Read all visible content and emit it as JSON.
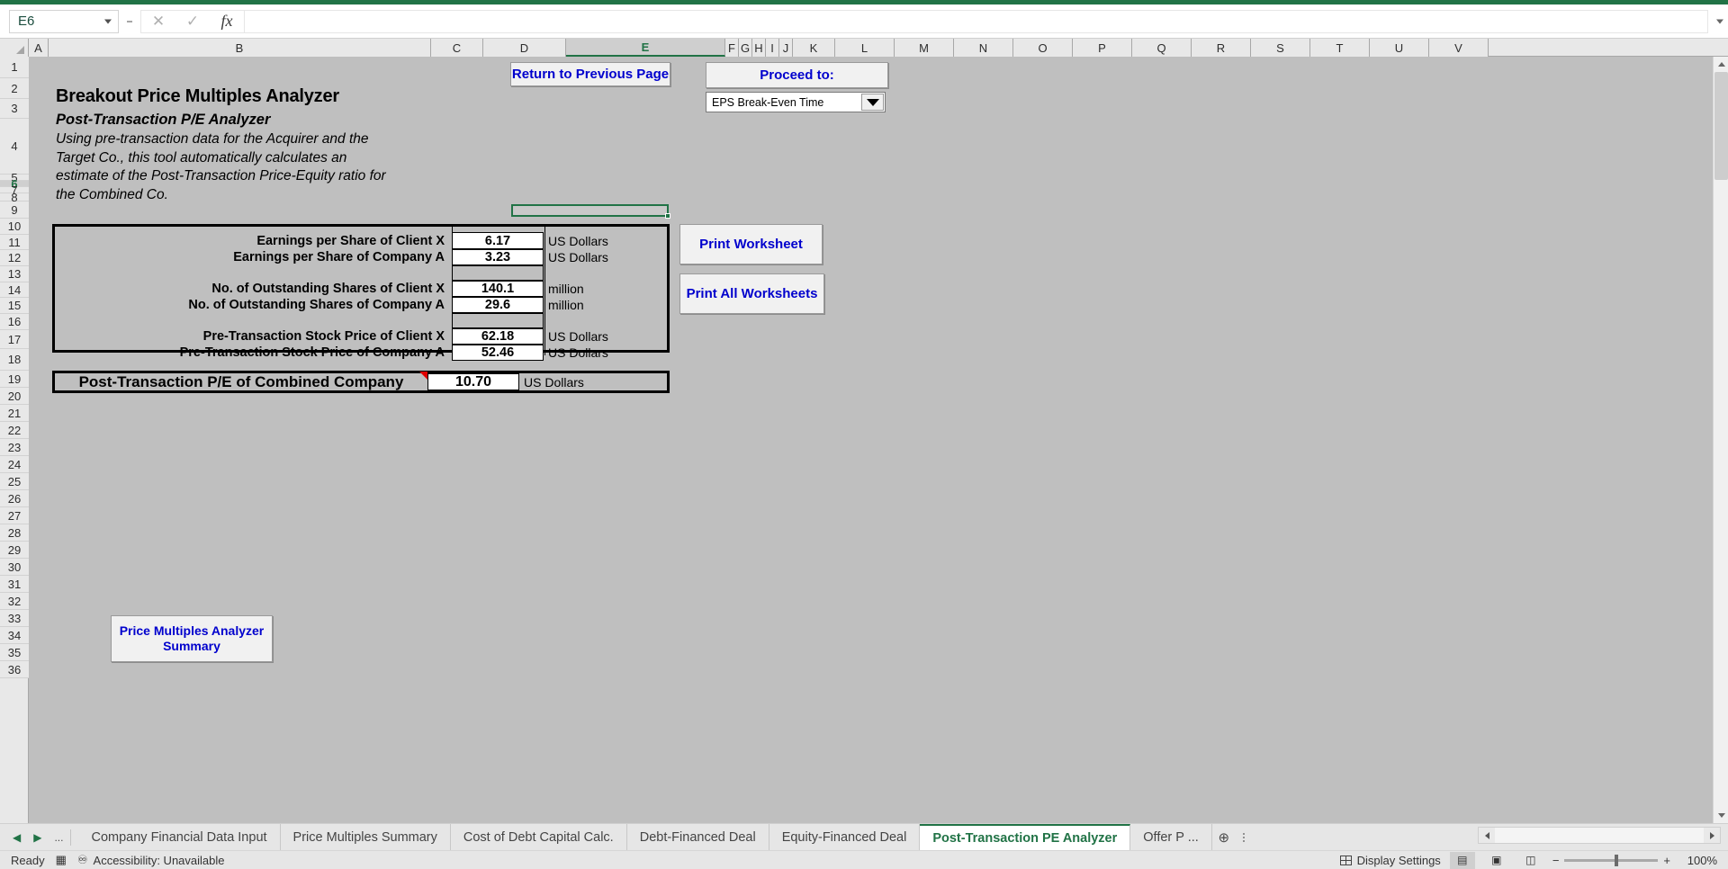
{
  "formula_bar": {
    "name_box_value": "E6",
    "formula_value": "",
    "cancel_icon": "close-icon",
    "confirm_icon": "check-icon",
    "function_icon": "fx-icon"
  },
  "columns": [
    "A",
    "B",
    "C",
    "D",
    "E",
    "F",
    "G",
    "H",
    "I",
    "J",
    "K",
    "L",
    "M",
    "N",
    "O",
    "P",
    "Q",
    "R",
    "S",
    "T",
    "U",
    "V"
  ],
  "selected_column": "E",
  "rows": [
    "1",
    "2",
    "3",
    "4",
    "5",
    "6",
    "7",
    "8",
    "9",
    "10",
    "11",
    "12",
    "13",
    "14",
    "15",
    "16",
    "17",
    "18",
    "19",
    "20",
    "21",
    "22",
    "23",
    "24",
    "25",
    "26",
    "27",
    "28",
    "29",
    "30",
    "31",
    "32",
    "33",
    "34",
    "35",
    "36"
  ],
  "selected_row": "6",
  "worksheet": {
    "title": "Breakout Price Multiples Analyzer",
    "subtitle": "Post-Transaction P/E Analyzer",
    "description": "Using pre-transaction data for the Acquirer and the Target Co., this tool automatically calculates an estimate of the Post-Transaction Price-Equity ratio for the Combined Co.",
    "buttons": {
      "return_previous": "Return to Previous Page",
      "proceed_to": "Proceed to:",
      "print_worksheet": "Print Worksheet",
      "print_all_worksheets": "Print All Worksheets",
      "price_multiples_summary": "Price Multiples Analyzer Summary"
    },
    "proceed_dropdown": {
      "selected": "EPS Break-Even Time",
      "arrow_icon": "chevron-down-icon"
    },
    "data_rows": [
      {
        "label": "Earnings per Share of Client X",
        "value": "6.17",
        "unit": "US Dollars",
        "blank": false
      },
      {
        "label": "Earnings per Share of Company A",
        "value": "3.23",
        "unit": "US Dollars",
        "blank": false
      },
      {
        "label": "",
        "value": "",
        "unit": "",
        "blank": true
      },
      {
        "label": "No. of Outstanding Shares of Client X",
        "value": "140.1",
        "unit": "million",
        "blank": false
      },
      {
        "label": "No. of Outstanding Shares of Company A",
        "value": "29.6",
        "unit": "million",
        "blank": false
      },
      {
        "label": "",
        "value": "",
        "unit": "",
        "blank": true
      },
      {
        "label": "Pre-Transaction Stock Price of Client X",
        "value": "62.18",
        "unit": "US Dollars",
        "blank": false
      },
      {
        "label": "Pre-Transaction Stock Price of Company A",
        "value": "52.46",
        "unit": "US Dollars",
        "blank": false
      }
    ],
    "result": {
      "label": "Post-Transaction P/E of Combined Company",
      "value": "10.70",
      "unit": "US Dollars",
      "comment_marker": "comment-indicator-icon"
    }
  },
  "sheet_tabs": {
    "nav_first_icon": "nav-previous-icon",
    "nav_next_icon": "nav-next-icon",
    "nav_ellipsis": "...",
    "items": [
      {
        "label": "Company Financial Data Input",
        "active": false
      },
      {
        "label": "Price Multiples Summary",
        "active": false
      },
      {
        "label": "Cost of Debt Capital Calc.",
        "active": false
      },
      {
        "label": "Debt-Financed Deal",
        "active": false
      },
      {
        "label": "Equity-Financed Deal",
        "active": false
      },
      {
        "label": "Post-Transaction PE Analyzer",
        "active": true
      },
      {
        "label": "Offer P ...",
        "active": false
      }
    ],
    "add_sheet_icon": "add-sheet-icon",
    "more_icon": "more-options-icon"
  },
  "status_bar": {
    "state": "Ready",
    "macro_icon": "record-macro-icon",
    "accessibility_icon": "accessibility-icon",
    "accessibility_text": "Accessibility: Unavailable",
    "display_settings": "Display Settings",
    "display_settings_icon": "display-settings-icon",
    "view_normal_icon": "normal-view-icon",
    "view_pagelayout_icon": "page-layout-view-icon",
    "view_pagebreak_icon": "page-break-view-icon",
    "zoom_out_icon": "zoom-out-icon",
    "zoom_in_icon": "zoom-in-icon",
    "zoom_level": "100%"
  },
  "colors": {
    "excel_green": "#217346",
    "button_text_blue": "#0000cd",
    "sheet_background": "#bfbfbf",
    "comment_marker_red": "#e00000"
  }
}
